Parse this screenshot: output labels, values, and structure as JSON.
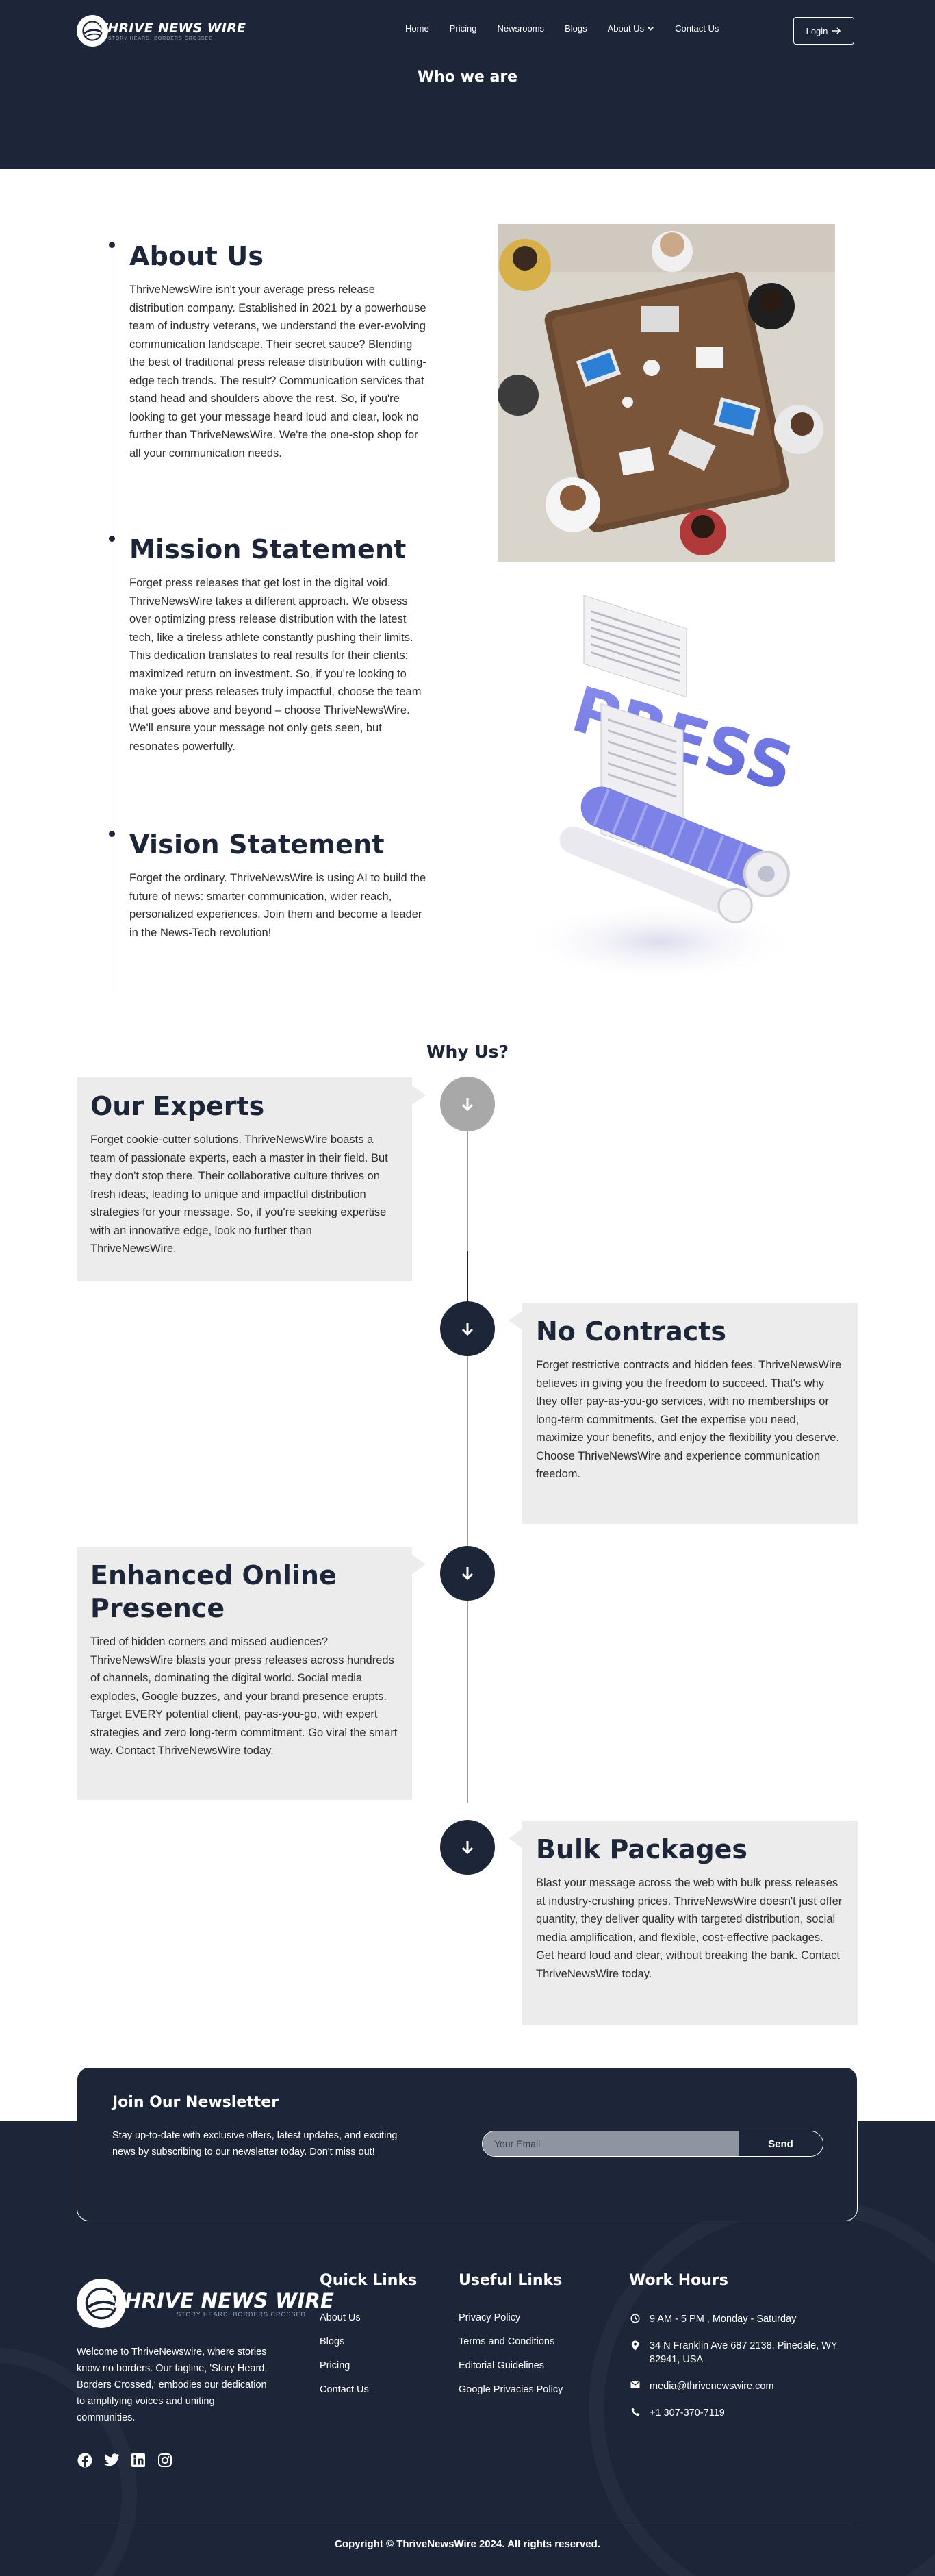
{
  "brand": {
    "name": "THRIVE NEWS WIRE",
    "tagline": "STORY HEARD, BORDERS CROSSED"
  },
  "nav": {
    "items": [
      "Home",
      "Pricing",
      "Newsrooms",
      "Blogs",
      "About Us",
      "Contact Us"
    ],
    "login_label": "Login"
  },
  "hero": {
    "title": "Who we are"
  },
  "about": {
    "blocks": [
      {
        "heading": "About Us",
        "text": "ThriveNewsWire isn't your average press release distribution company. Established in 2021 by a powerhouse team of industry veterans, we understand the ever-evolving communication landscape. Their secret sauce? Blending the best of traditional press release distribution with cutting-edge tech trends. The result? Communication services that stand head and shoulders above the rest. So, if you're looking to get your message heard loud and clear, look no further than ThriveNewsWire. We're the one-stop shop for all your communication needs."
      },
      {
        "heading": "Mission Statement",
        "text": "Forget press releases that get lost in the digital void. ThriveNewsWire takes a different approach. We obsess over optimizing press release distribution with the latest tech, like a tireless athlete constantly pushing their limits. This dedication translates to real results for their clients: maximized return on investment. So, if you're looking to make your press releases truly impactful, choose the team that goes above and beyond – choose ThriveNewsWire. We'll ensure your message not only gets seen, but resonates powerfully."
      },
      {
        "heading": "Vision Statement",
        "text": "Forget the ordinary. ThriveNewsWire is using AI to build the future of news: smarter communication, wider reach, personalized experiences. Join them and become a leader in the News-Tech revolution!"
      }
    ],
    "press_word": "PRESS"
  },
  "why": {
    "title": "Why Us?",
    "items": [
      {
        "heading": "Our Experts",
        "text": "Forget cookie-cutter solutions. ThriveNewsWire boasts a team of passionate experts, each a master in their field. But they don't stop there. Their collaborative culture thrives on fresh ideas, leading to unique and impactful distribution strategies for your message. So, if you're seeking expertise with an innovative edge, look no further than ThriveNewsWire."
      },
      {
        "heading": "No Contracts",
        "text": "Forget restrictive contracts and hidden fees. ThriveNewsWire believes in giving you the freedom to succeed. That's why they offer pay-as-you-go services, with no memberships or long-term commitments. Get the expertise you need, maximize your benefits, and enjoy the flexibility you deserve. Choose ThriveNewsWire and experience communication freedom."
      },
      {
        "heading": "Enhanced Online Presence",
        "text": "Tired of hidden corners and missed audiences? ThriveNewsWire blasts your press releases across hundreds of channels, dominating the digital world. Social media explodes, Google buzzes, and your brand presence erupts. Target EVERY potential client, pay-as-you-go, with expert strategies and zero long-term commitment. Go viral the smart way. Contact ThriveNewsWire today."
      },
      {
        "heading": "Bulk Packages",
        "text": "Blast your message across the web with bulk press releases at industry-crushing prices. ThriveNewsWire doesn't just offer quantity, they deliver quality with targeted distribution, social media amplification, and flexible, cost-effective packages. Get heard loud and clear, without breaking the bank. Contact ThriveNewsWire today."
      }
    ]
  },
  "newsletter": {
    "title": "Join Our Newsletter",
    "text": "Stay up-to-date with exclusive offers, latest updates, and exciting news by subscribing to our newsletter today. Don't miss out!",
    "placeholder": "Your Email",
    "send_label": "Send"
  },
  "footer": {
    "about": "Welcome to ThriveNewswire, where stories know no borders. Our tagline, 'Story Heard, Borders Crossed,' embodies our dedication to amplifying voices and uniting communities.",
    "quick_links": {
      "title": "Quick Links",
      "items": [
        "About Us",
        "Blogs",
        "Pricing",
        "Contact Us"
      ]
    },
    "useful_links": {
      "title": "Useful Links",
      "items": [
        "Privacy Policy",
        "Terms and Conditions",
        "Editorial Guidelines",
        "Google Privacies Policy"
      ]
    },
    "work_hours": {
      "title": "Work Hours",
      "hours": "9 AM - 5 PM , Monday - Saturday",
      "address": "34 N Franklin Ave 687 2138, Pinedale, WY 82941, USA",
      "email": "media@thrivenewswire.com",
      "phone": "+1 307-370-7119"
    },
    "social_icons": [
      "facebook-icon",
      "twitter-icon",
      "linkedin-icon",
      "instagram-icon"
    ],
    "copyright": "Copyright © ThriveNewsWire 2024. All rights reserved."
  },
  "colors": {
    "navy": "#1d2538",
    "card_grey": "#ececec",
    "circle_grey": "#a8a8a8",
    "press_blue": "#5b63d6"
  }
}
